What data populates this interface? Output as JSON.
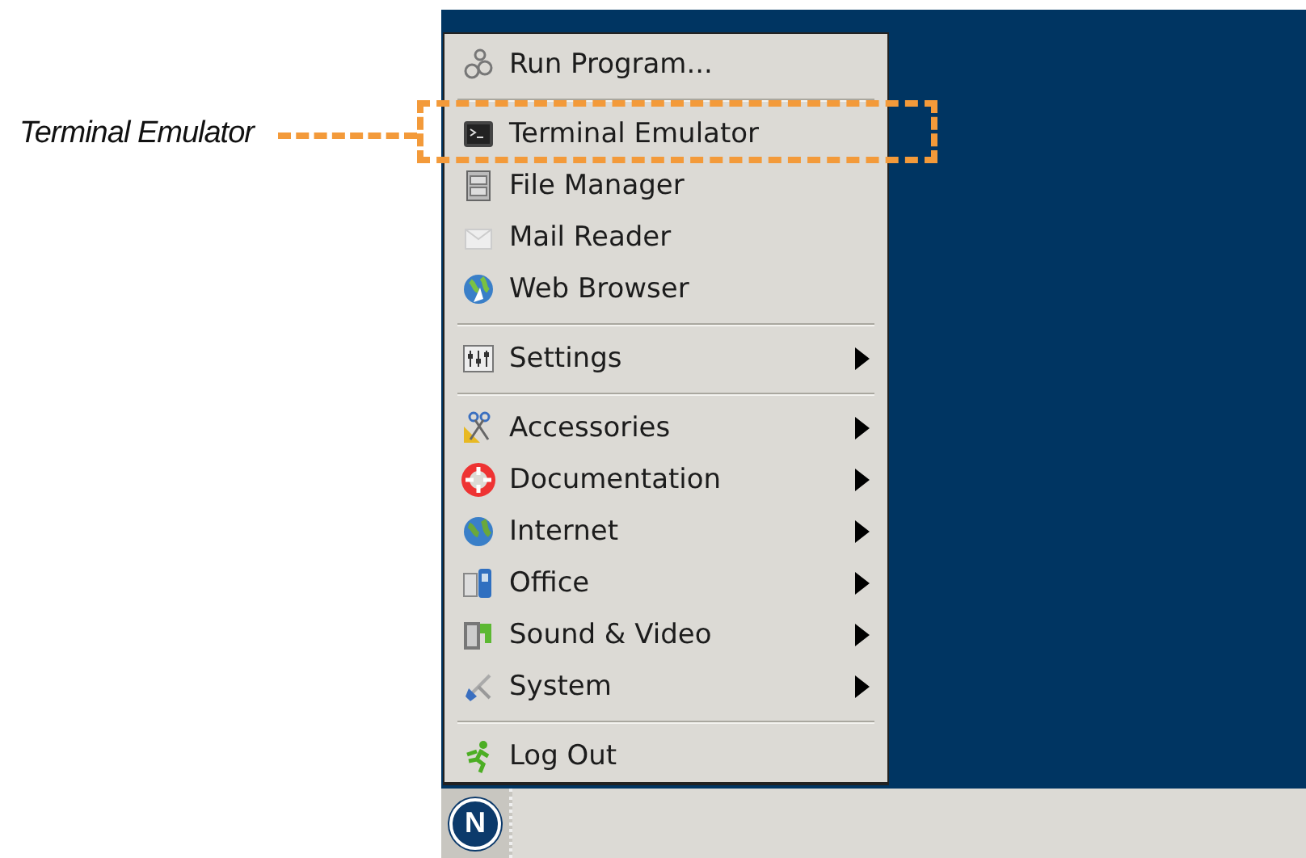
{
  "callout": {
    "label": "Terminal Emulator"
  },
  "menu": {
    "items": [
      {
        "kind": "item",
        "label": "Run Program...",
        "submenu": false
      },
      {
        "kind": "separator"
      },
      {
        "kind": "item",
        "label": "Terminal Emulator",
        "submenu": false
      },
      {
        "kind": "item",
        "label": "File Manager",
        "submenu": false
      },
      {
        "kind": "item",
        "label": "Mail Reader",
        "submenu": false
      },
      {
        "kind": "item",
        "label": "Web Browser",
        "submenu": false
      },
      {
        "kind": "separator"
      },
      {
        "kind": "item",
        "label": "Settings",
        "submenu": true
      },
      {
        "kind": "separator"
      },
      {
        "kind": "item",
        "label": "Accessories",
        "submenu": true
      },
      {
        "kind": "item",
        "label": "Documentation",
        "submenu": true
      },
      {
        "kind": "item",
        "label": "Internet",
        "submenu": true
      },
      {
        "kind": "item",
        "label": "Office",
        "submenu": true
      },
      {
        "kind": "item",
        "label": "Sound & Video",
        "submenu": true
      },
      {
        "kind": "item",
        "label": "System",
        "submenu": true
      },
      {
        "kind": "separator"
      },
      {
        "kind": "item",
        "label": "Log Out",
        "submenu": false
      }
    ]
  },
  "taskbar": {
    "start_button": "N"
  }
}
